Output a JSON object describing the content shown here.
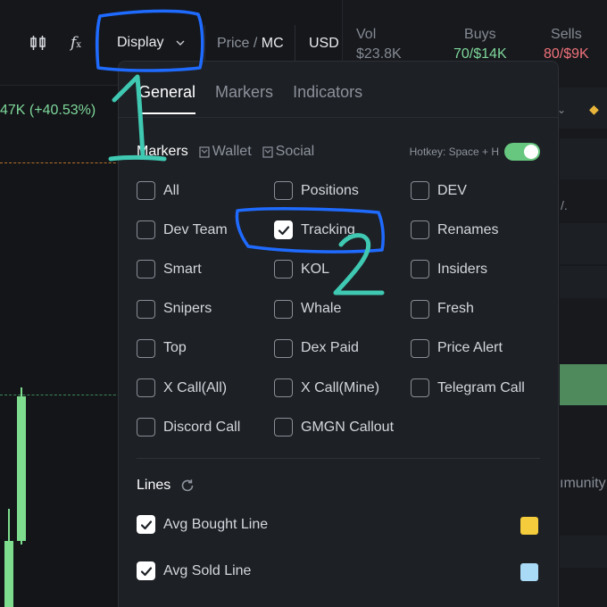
{
  "toolbar": {
    "display_label": "Display",
    "price_label": "Price /",
    "mc_label": "MC",
    "usd_label": "USD"
  },
  "chart": {
    "change_text": "47K (+40.53%)"
  },
  "stats": {
    "vol_label": "Vol",
    "vol_value": "$23.8K",
    "buys_label": "Buys",
    "buys_value": "70/$14K",
    "sells_label": "Sells",
    "sells_value": "80/$9K"
  },
  "side": {
    "community_text": "ımunity",
    "truncated_text": "/."
  },
  "popup": {
    "tabs": [
      {
        "label": "General",
        "active": true
      },
      {
        "label": "Markers",
        "active": false
      },
      {
        "label": "Indicators",
        "active": false
      }
    ],
    "markers": {
      "title": "Markers",
      "filters": [
        "Wallet",
        "Social"
      ],
      "hotkey": "Hotkey: Space + H",
      "toggle_on": true,
      "items": [
        {
          "label": "All",
          "checked": false
        },
        {
          "label": "Positions",
          "checked": false
        },
        {
          "label": "DEV",
          "checked": false
        },
        {
          "label": "Dev Team",
          "checked": false
        },
        {
          "label": "Tracking",
          "checked": true
        },
        {
          "label": "Renames",
          "checked": false
        },
        {
          "label": "Smart",
          "checked": false
        },
        {
          "label": "KOL",
          "checked": false
        },
        {
          "label": "Insiders",
          "checked": false
        },
        {
          "label": "Snipers",
          "checked": false
        },
        {
          "label": "Whale",
          "checked": false
        },
        {
          "label": "Fresh",
          "checked": false
        },
        {
          "label": "Top",
          "checked": false
        },
        {
          "label": "Dex Paid",
          "checked": false
        },
        {
          "label": "Price Alert",
          "checked": false
        },
        {
          "label": "X Call(All)",
          "checked": false
        },
        {
          "label": "X Call(Mine)",
          "checked": false
        },
        {
          "label": "Telegram Call",
          "checked": false
        },
        {
          "label": "Discord Call",
          "checked": false
        },
        {
          "label": "GMGN Callout",
          "checked": false
        }
      ]
    },
    "lines": {
      "title": "Lines",
      "items": [
        {
          "label": "Avg Bought Line",
          "checked": true,
          "color": "#f5cc3b"
        },
        {
          "label": "Avg Sold Line",
          "checked": true,
          "color": "#a9dbf7"
        }
      ]
    }
  },
  "annotations": {
    "color_blue": "#1f6bff",
    "color_teal": "#3fc9b2",
    "labels": [
      "1",
      "2"
    ]
  }
}
